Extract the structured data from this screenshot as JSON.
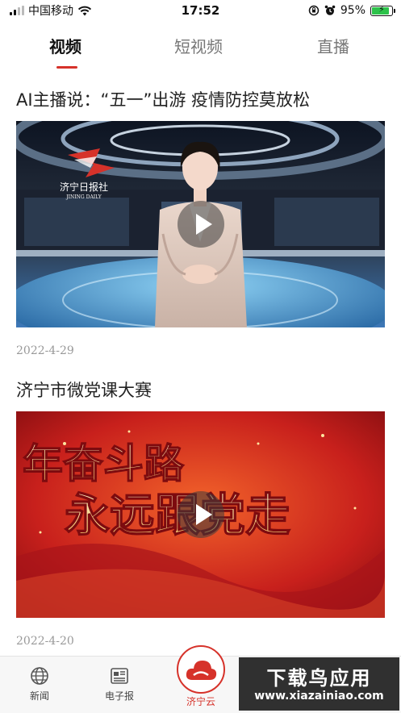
{
  "status_bar": {
    "carrier": "中国移动",
    "time": "17:52",
    "battery_percent": "95%",
    "battery_level": 0.95,
    "icons": [
      "signal-icon",
      "wifi-icon",
      "orientation-lock-icon",
      "alarm-icon",
      "battery-charging-icon"
    ]
  },
  "tabs": {
    "items": [
      "视频",
      "短视频",
      "直播"
    ],
    "active": "视频"
  },
  "articles": [
    {
      "title": "AI主播说：“五一”出游 疫情防控莫放松",
      "date": "2022-4-29",
      "thumbnail_logo": "济宁日报社",
      "thumbnail_logo_sub": "JINING DAILY"
    },
    {
      "title": "济宁市微党课大赛",
      "date": "2022-4-20",
      "thumbnail_text_line1": "年奋斗路",
      "thumbnail_text_line2": "永远跟党走"
    }
  ],
  "bottom_nav": {
    "items": [
      {
        "label": "新闻",
        "icon": "globe-icon"
      },
      {
        "label": "电子报",
        "icon": "newspaper-icon"
      },
      {
        "label": "济宁云",
        "icon": "cloud-icon"
      }
    ]
  },
  "watermark": {
    "line1": "下载鸟应用",
    "line2": "www.xiazainiao.com"
  },
  "colors": {
    "accent": "#d6322a",
    "text": "#222222",
    "muted": "#999999"
  }
}
